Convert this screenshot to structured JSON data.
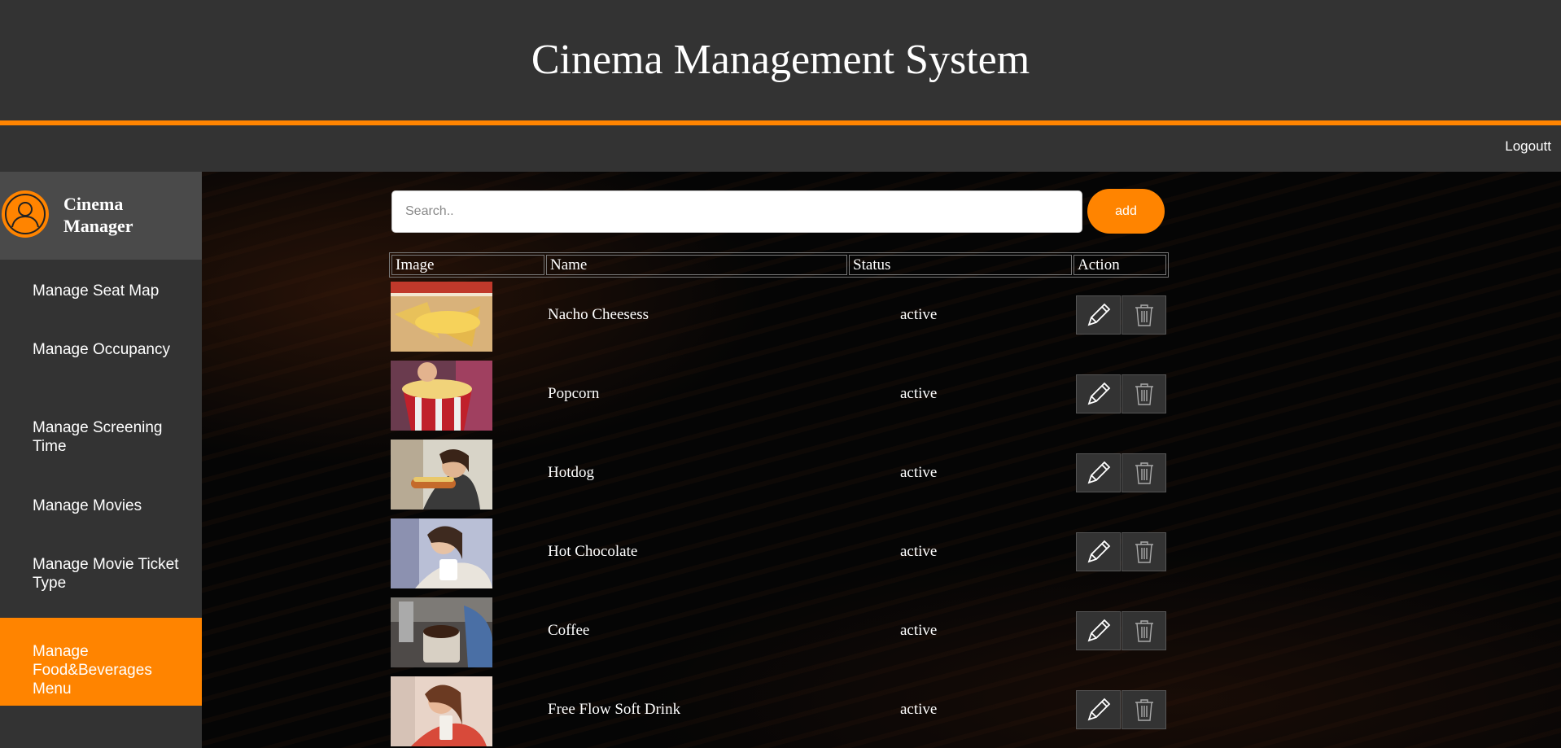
{
  "header": {
    "title": "Cinema Management System"
  },
  "topnav": {
    "logout_label": "Logoutt"
  },
  "sidebar": {
    "profile_name": "Cinema Manager",
    "items": [
      {
        "label": "Manage Seat Map",
        "active": false
      },
      {
        "label": "Manage Occupancy",
        "active": false
      },
      {
        "label": "Manage Screening Time",
        "active": false
      },
      {
        "label": "Manage Movies",
        "active": false
      },
      {
        "label": "Manage Movie Ticket Type",
        "active": false
      },
      {
        "label": "Manage Food&Beverages Menu",
        "active": true
      }
    ]
  },
  "search": {
    "placeholder": "Search..",
    "value": ""
  },
  "add_label": "add",
  "table": {
    "columns": [
      "Image",
      "Name",
      "Status",
      "Action"
    ],
    "rows": [
      {
        "name": "Nacho Cheesess",
        "status": "active"
      },
      {
        "name": "Popcorn",
        "status": "active"
      },
      {
        "name": "Hotdog",
        "status": "active"
      },
      {
        "name": "Hot Chocolate",
        "status": "active"
      },
      {
        "name": "Coffee",
        "status": "active"
      },
      {
        "name": "Free Flow Soft Drink",
        "status": "active"
      }
    ]
  },
  "colors": {
    "accent": "#ff8400",
    "panel": "#333333",
    "profile_panel": "#4a4a4a"
  },
  "icons": {
    "avatar": "user-avatar-icon",
    "edit": "pencil-icon",
    "delete": "trash-icon"
  }
}
